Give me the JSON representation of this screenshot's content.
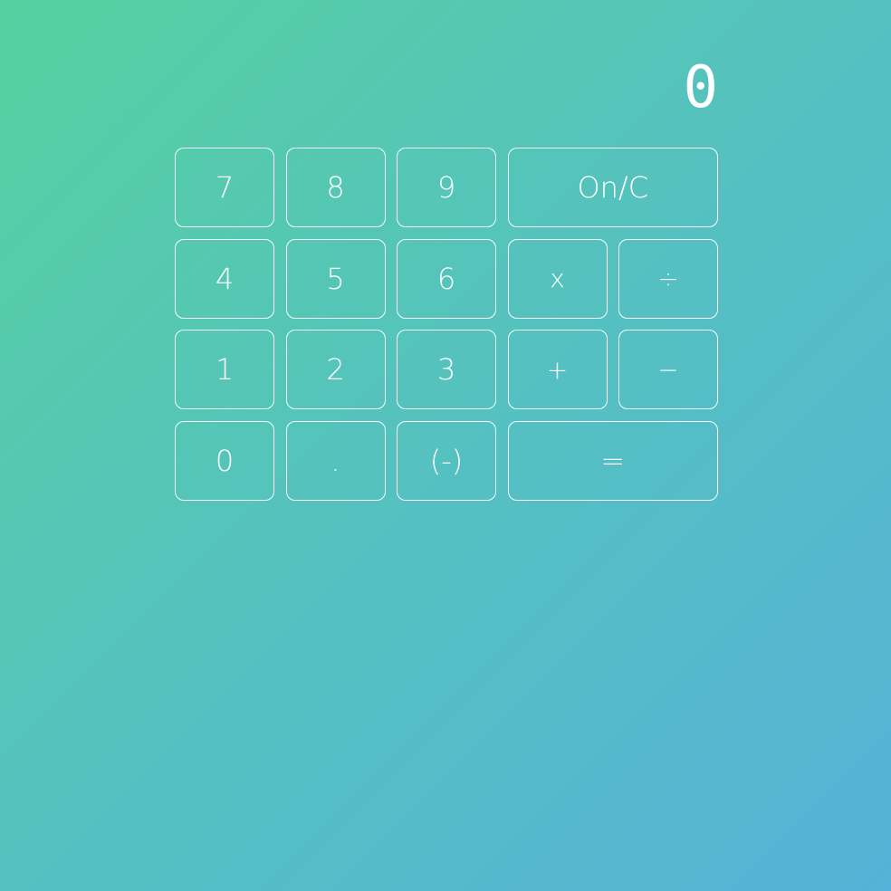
{
  "display": {
    "value": "0"
  },
  "keys": {
    "seven": "7",
    "eight": "8",
    "nine": "9",
    "clear": "On/C",
    "four": "4",
    "five": "5",
    "six": "6",
    "multiply": "x",
    "divide": "÷",
    "one": "1",
    "two": "2",
    "three": "3",
    "add": "+",
    "subtract": "−",
    "zero": "0",
    "decimal": ".",
    "negate": "(-)",
    "equals": "="
  }
}
